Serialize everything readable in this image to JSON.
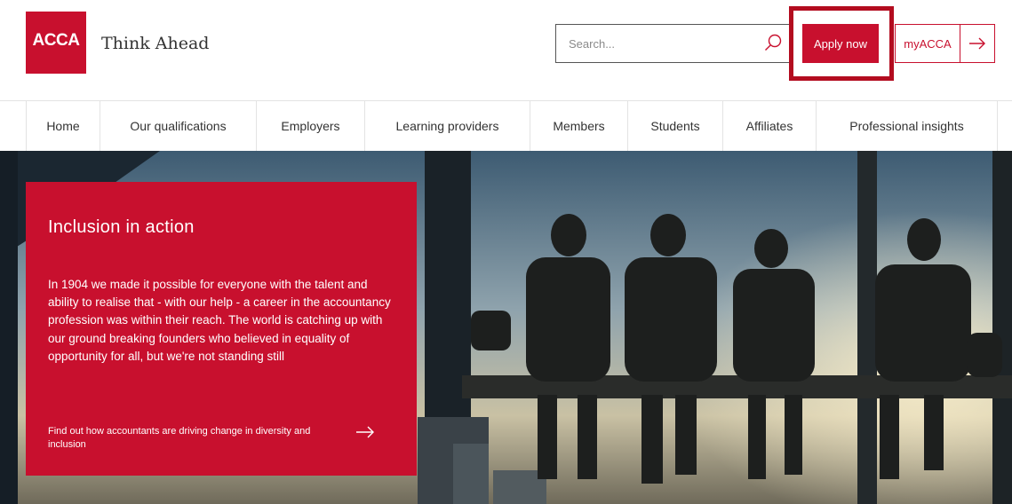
{
  "header": {
    "logo_text": "ACCA",
    "tagline": "Think Ahead",
    "search_placeholder": "Search...",
    "apply_label": "Apply now",
    "myacca_label": "myACCA"
  },
  "nav": {
    "items": [
      "Home",
      "Our qualifications",
      "Employers",
      "Learning providers",
      "Members",
      "Students",
      "Affiliates",
      "Professional insights"
    ]
  },
  "hero": {
    "title": "Inclusion in action",
    "body": "In 1904 we made it possible for everyone with the talent and ability to realise that - with our help - a career in the accountancy profession was within their reach. The world is catching up with our ground breaking founders who believed in equality of opportunity for all, but we're not standing still",
    "cta": "Find out how accountants are driving change in diversity and inclusion"
  },
  "colors": {
    "brand_red": "#c8102e",
    "highlight_border": "#b30c1f"
  },
  "icons": {
    "search": "search-icon",
    "arrow": "arrow-right-icon"
  }
}
